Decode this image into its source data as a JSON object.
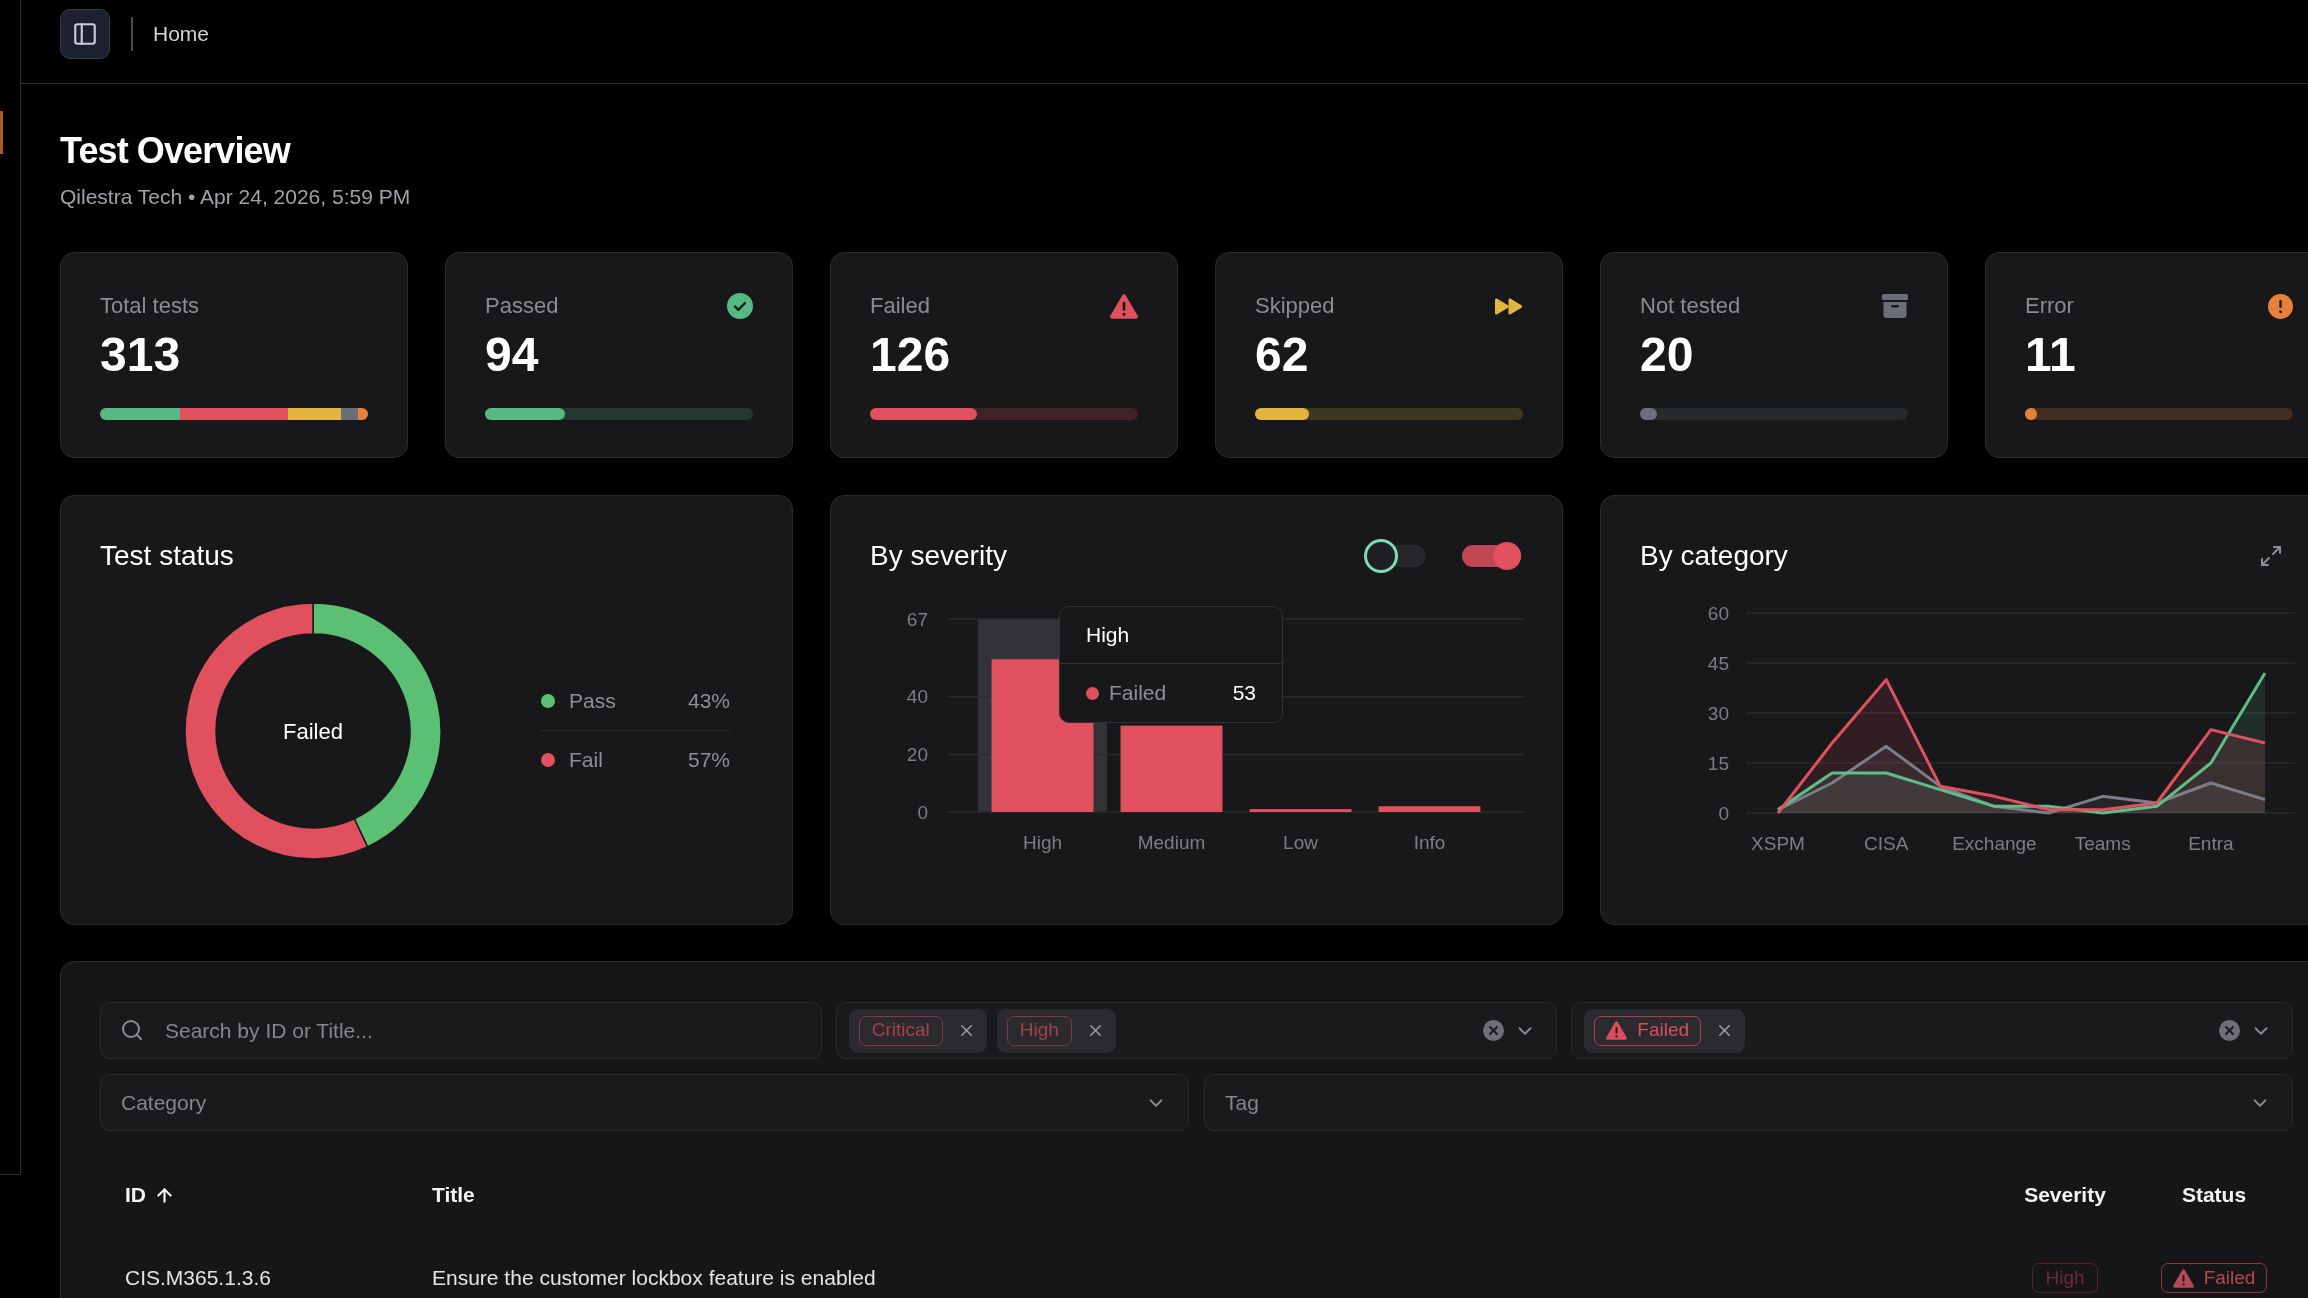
{
  "header": {
    "breadcrumb": "Home"
  },
  "page": {
    "title": "Test Overview",
    "subtitle": "Qilestra Tech • Apr 24, 2026, 5:59 PM"
  },
  "stat_cards": [
    {
      "kind": "total",
      "label": "Total tests",
      "value": "313"
    },
    {
      "kind": "passed",
      "label": "Passed",
      "value": "94",
      "color": "#57b884",
      "level": 0.3
    },
    {
      "kind": "failed",
      "label": "Failed",
      "value": "126",
      "color": "#e0505f",
      "level": 0.4
    },
    {
      "kind": "skipped",
      "label": "Skipped",
      "value": "62",
      "color": "#e2b53e",
      "level": 0.2
    },
    {
      "kind": "not-tested",
      "label": "Not tested",
      "value": "20",
      "color": "#6b6e78",
      "level": 0.064
    },
    {
      "kind": "error",
      "label": "Error",
      "value": "11",
      "color": "#e8803a",
      "level": 0.035
    }
  ],
  "charts": [
    {
      "title": "Test status",
      "center_label": "Failed",
      "legend": [
        {
          "value": "43%",
          "color": "#5bc074"
        },
        {
          "value": "57%",
          "color": "#e0505f"
        }
      ],
      "chart_data": {
        "type": "donut",
        "categories": [
          "Pass",
          "Fail"
        ],
        "values": [
          43,
          57
        ]
      }
    },
    {
      "title": "By severity",
      "toggles": [
        {
          "on": false,
          "color": "#7ddcb4"
        },
        {
          "on": true,
          "color": "#e0505f"
        }
      ],
      "tooltip": {
        "title": "High",
        "label": "Failed",
        "value": "53",
        "color": "#e0505f"
      },
      "chart_data": {
        "type": "bar",
        "categories": [
          "High",
          "Medium",
          "Low",
          "Info"
        ],
        "series": [
          {
            "color": "#e0505f",
            "values": [
              53,
              30,
              1,
              2
            ]
          }
        ],
        "ylim": [
          0,
          67
        ],
        "yticks": [
          0,
          20,
          40,
          67
        ],
        "grid": true,
        "bands": [
          {
            "axis": "x",
            "from": "High",
            "to": "High"
          }
        ]
      }
    },
    {
      "title": "By category",
      "chart_data": {
        "type": "area",
        "categories": [
          "XSPM",
          null,
          "CISA",
          null,
          "Exchange",
          null,
          "Teams",
          null,
          "Entra",
          null
        ],
        "ylim": [
          0,
          60
        ],
        "yticks": [
          0,
          15,
          30,
          45,
          60
        ],
        "grid": true,
        "series": [
          {
            "color": "#7b7d88",
            "values": [
              1,
              9,
              20,
              8,
              2,
              0,
              5,
              3,
              9,
              4
            ]
          },
          {
            "color": "#5cbf8a",
            "values": [
              1,
              12,
              12,
              7,
              2,
              2,
              0,
              2,
              15,
              42
            ]
          },
          {
            "color": "#e0505f",
            "values": [
              0,
              21,
              40,
              8,
              5,
              1,
              1,
              3,
              25,
              21
            ]
          }
        ]
      }
    }
  ],
  "filters": {
    "search": {
      "placeholder": "Search by ID or Title..."
    },
    "severity": {
      "tags": [
        {
          "label": "Critical",
          "kind": "plain",
          "color": "#a8404d"
        },
        {
          "label": "High",
          "kind": "plain",
          "color": "#a3404c"
        }
      ]
    },
    "status": {
      "tags": [
        {
          "label": "Failed",
          "kind": "alert",
          "color": "#dc4d5d"
        }
      ]
    },
    "category": {
      "placeholder": "Category"
    },
    "tag": {
      "placeholder": "Tag"
    }
  },
  "table": {
    "columns": [
      {
        "label": "ID",
        "sorted": true
      },
      {
        "label": "Title",
        "sorted": false
      },
      {
        "label": "Severity",
        "sorted": false
      },
      {
        "label": "Status",
        "sorted": false
      }
    ],
    "rows": [
      {
        "id": "CIS.M365.1.3.6",
        "title": "Ensure the customer lockbox feature is enabled",
        "severity": {
          "label": "High",
          "kind": "plain",
          "color": "#6b2c35"
        },
        "status": {
          "label": "Failed",
          "kind": "alert",
          "color": "#b54856"
        }
      }
    ]
  }
}
